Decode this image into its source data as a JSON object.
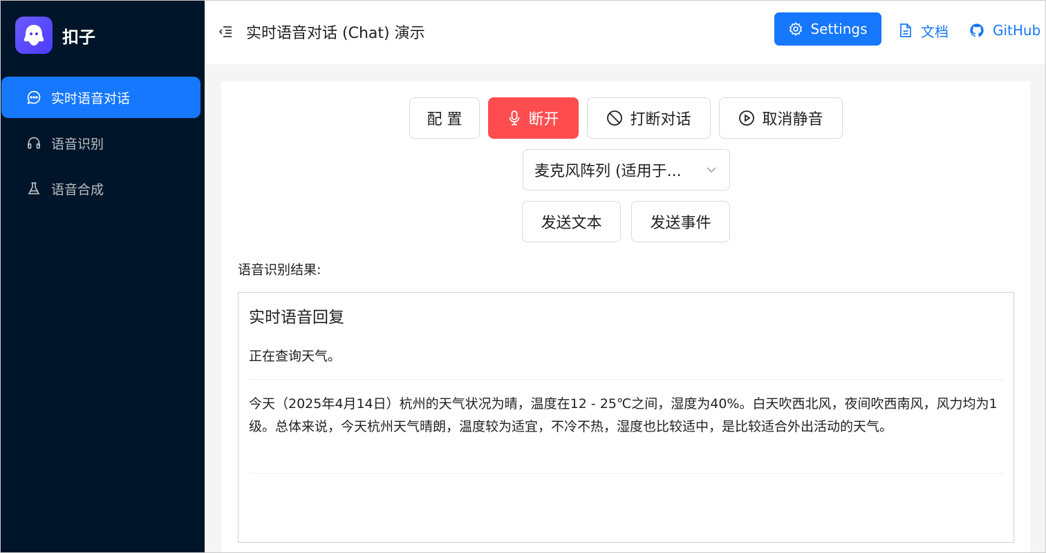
{
  "sidebar": {
    "logo_text": "扣子",
    "items": [
      {
        "label": "实时语音对话",
        "icon": "chat-bubble-icon",
        "active": true
      },
      {
        "label": "语音识别",
        "icon": "headphones-icon",
        "active": false
      },
      {
        "label": "语音合成",
        "icon": "flask-icon",
        "active": false
      }
    ]
  },
  "header": {
    "title": "实时语音对话 (Chat) 演示",
    "settings_label": "Settings",
    "docs_label": "文档",
    "github_label": "GitHub"
  },
  "controls": {
    "config_label": "配 置",
    "disconnect_label": "断开",
    "interrupt_label": "打断对话",
    "unmute_label": "取消静音",
    "mic_select_value": "麦克风阵列 (适用于...",
    "send_text_label": "发送文本",
    "send_event_label": "发送事件"
  },
  "result": {
    "label": "语音识别结果:",
    "title": "实时语音回复",
    "messages": [
      "正在查询天气。",
      "今天（2025年4月14日）杭州的天气状况为晴，温度在12 - 25℃之间，湿度为40%。白天吹西北风，夜间吹西南风，风力均为1级。总体来说，今天杭州天气晴朗，温度较为适宜，不冷不热，湿度也比较适中，是比较适合外出活动的天气。"
    ]
  },
  "colors": {
    "primary": "#1677ff",
    "danger": "#ff4d4f",
    "sidebar_bg": "#001529"
  }
}
